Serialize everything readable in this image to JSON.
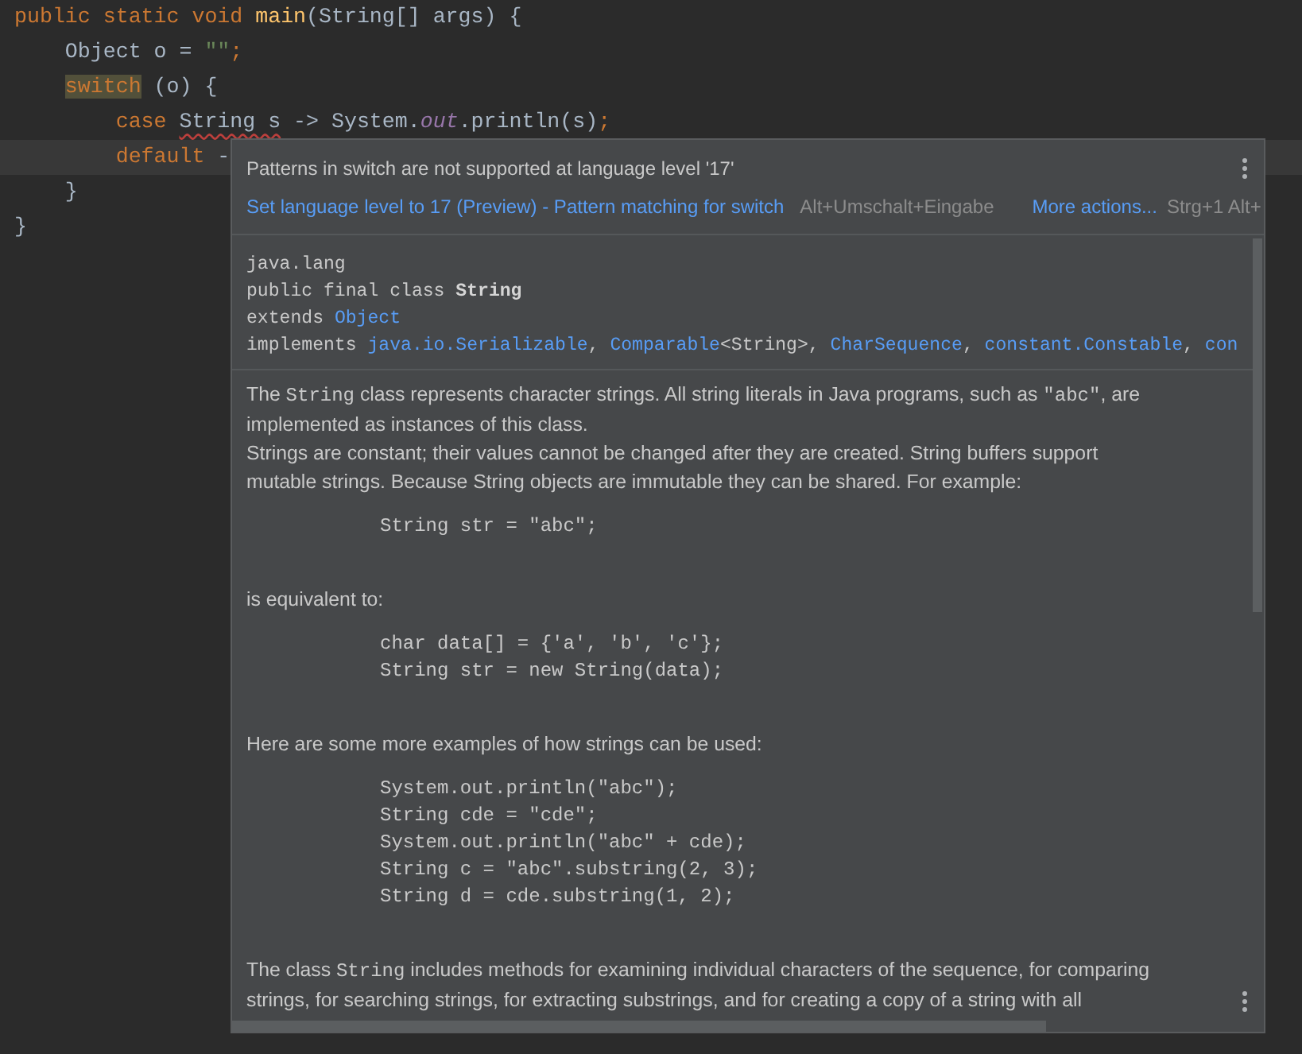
{
  "editor": {
    "lines": [
      {
        "current": false,
        "tokens": [
          {
            "text": "public static void ",
            "kind": "keyword"
          },
          {
            "text": "main",
            "kind": "method"
          },
          {
            "text": "(String[] args) {",
            "kind": "plain"
          }
        ]
      },
      {
        "current": false,
        "tokens": [
          {
            "text": "    Object o = ",
            "kind": "plain"
          },
          {
            "text": "\"\"",
            "kind": "string"
          },
          {
            "text": ";",
            "kind": "keyword"
          }
        ]
      },
      {
        "current": false,
        "tokens": [
          {
            "text": "    switch",
            "kind": "match"
          },
          {
            "text": " (o) {",
            "kind": "plain"
          }
        ]
      },
      {
        "current": false,
        "tokens": [
          {
            "text": "        case ",
            "kind": "keyword"
          },
          {
            "text": "String s",
            "kind": "error"
          },
          {
            "text": " -> System.",
            "kind": "plain"
          },
          {
            "text": "out",
            "kind": "field"
          },
          {
            "text": ".println(s)",
            "kind": "plain"
          },
          {
            "text": ";",
            "kind": "keyword"
          }
        ]
      },
      {
        "current": true,
        "tokens": [
          {
            "text": "        default ",
            "kind": "keyword"
          },
          {
            "text": "-",
            "kind": "plain"
          }
        ]
      },
      {
        "current": false,
        "tokens": [
          {
            "text": "    }",
            "kind": "plain"
          }
        ]
      },
      {
        "current": false,
        "tokens": [
          {
            "text": "}",
            "kind": "plain"
          }
        ]
      }
    ]
  },
  "popup": {
    "message": "Patterns in switch are not supported at language level '17'",
    "action": {
      "label": "Set language level to 17 (Preview) - Pattern matching for switch",
      "shortcut": "Alt+Umschalt+Eingabe"
    },
    "more": {
      "label": "More actions...",
      "shortcut": "Strg+1 Alt+"
    },
    "signature": [
      [
        {
          "text": "java.lang",
          "kind": "plain"
        }
      ],
      [
        {
          "text": "public final class ",
          "kind": "plain"
        },
        {
          "text": "String",
          "kind": "bold"
        }
      ],
      [
        {
          "text": "extends ",
          "kind": "plain"
        },
        {
          "text": "Object",
          "kind": "link"
        }
      ],
      [
        {
          "text": "implements ",
          "kind": "plain"
        },
        {
          "text": "java.io.Serializable",
          "kind": "link"
        },
        {
          "text": ", ",
          "kind": "plain"
        },
        {
          "text": "Comparable",
          "kind": "link"
        },
        {
          "text": "<String>",
          "kind": "plain"
        },
        {
          "text": ", ",
          "kind": "plain"
        },
        {
          "text": "CharSequence",
          "kind": "link"
        },
        {
          "text": ", ",
          "kind": "plain"
        },
        {
          "text": "constant.Constable",
          "kind": "link"
        },
        {
          "text": ", ",
          "kind": "plain"
        },
        {
          "text": "con",
          "kind": "link"
        }
      ]
    ],
    "blocks": [
      {
        "kind": "para",
        "lines": [
          [
            {
              "text": "The ",
              "kind": "text"
            },
            {
              "text": "String",
              "kind": "code"
            },
            {
              "text": " class represents character strings. All string literals in Java programs, such as ",
              "kind": "text"
            },
            {
              "text": "\"abc\"",
              "kind": "code"
            },
            {
              "text": ", are",
              "kind": "text"
            }
          ],
          [
            {
              "text": "implemented as instances of this class.",
              "kind": "text"
            }
          ],
          [
            {
              "text": "Strings are constant; their values cannot be changed after they are created. String buffers support",
              "kind": "text"
            }
          ],
          [
            {
              "text": "mutable strings. Because String objects are immutable they can be shared. For example:",
              "kind": "text"
            }
          ]
        ]
      },
      {
        "kind": "code",
        "lines": [
          "String str = \"abc\";"
        ]
      },
      {
        "kind": "para",
        "lines": [
          [
            {
              "text": "is equivalent to:",
              "kind": "text"
            }
          ]
        ]
      },
      {
        "kind": "code",
        "lines": [
          "char data[] = {'a', 'b', 'c'};",
          "String str = new String(data);"
        ]
      },
      {
        "kind": "para",
        "lines": [
          [
            {
              "text": "Here are some more examples of how strings can be used:",
              "kind": "text"
            }
          ]
        ]
      },
      {
        "kind": "code",
        "lines": [
          "System.out.println(\"abc\");",
          "String cde = \"cde\";",
          "System.out.println(\"abc\" + cde);",
          "String c = \"abc\".substring(2, 3);",
          "String d = cde.substring(1, 2);"
        ]
      },
      {
        "kind": "para",
        "lines": [
          [
            {
              "text": "The class ",
              "kind": "text"
            },
            {
              "text": "String",
              "kind": "code"
            },
            {
              "text": " includes methods for examining individual characters of the sequence, for comparing",
              "kind": "text"
            }
          ],
          [
            {
              "text": "strings, for searching strings, for extracting substrings, and for creating a copy of a string with all",
              "kind": "text"
            }
          ]
        ]
      }
    ]
  }
}
